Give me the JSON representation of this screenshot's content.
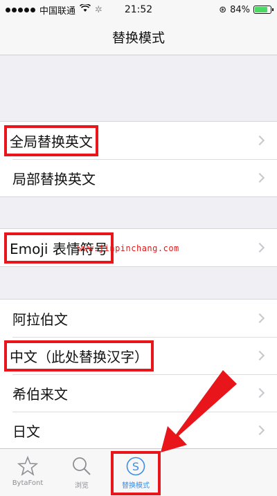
{
  "status": {
    "carrier": "中国联通",
    "time": "21:52",
    "battery": "84%",
    "battery_level": 0.84
  },
  "nav": {
    "title": "替换模式"
  },
  "sections": [
    {
      "items": [
        {
          "label": "全局替换英文",
          "highlighted": true
        },
        {
          "label": "局部替换英文",
          "highlighted": false
        }
      ]
    },
    {
      "items": [
        {
          "label": "Emoji 表情符号",
          "highlighted": true
        }
      ]
    },
    {
      "items": [
        {
          "label": "阿拉伯文",
          "highlighted": false
        },
        {
          "label": "中文（此处替换汉字）",
          "highlighted": true
        },
        {
          "label": "希伯来文",
          "highlighted": false
        },
        {
          "label": "日文",
          "highlighted": false
        }
      ]
    }
  ],
  "watermark": "www.jinpinchang.com",
  "tabs": [
    {
      "label": "BytaFont",
      "icon": "star-icon"
    },
    {
      "label": "浏览",
      "icon": "search-icon"
    },
    {
      "label": "替换模式",
      "icon": "s-circle-icon",
      "active": true
    }
  ],
  "colors": {
    "accent": "#3a8ee6",
    "highlight": "#e8151b"
  }
}
